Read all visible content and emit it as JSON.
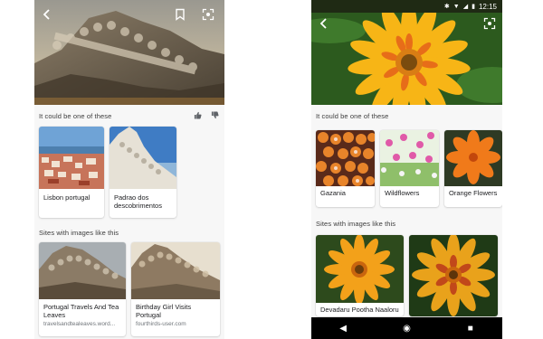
{
  "left_screen": {
    "related_heading": "It could be one of these",
    "related": [
      {
        "label": "Lisbon portugal"
      },
      {
        "label": "Padrao dos descobrimentos"
      }
    ],
    "sites_heading": "Sites with images like this",
    "sites": [
      {
        "title": "Portugal Travels And Tea Leaves",
        "source": "travelsandtealeaves.word..."
      },
      {
        "title": "Birthday Girl Visits Portugal",
        "source": "fourthirds-user.com"
      }
    ]
  },
  "right_screen": {
    "status_time": "12:15",
    "related_heading": "It could be one of these",
    "related": [
      {
        "label": "Gazania"
      },
      {
        "label": "Wildflowers"
      },
      {
        "label": "Orange Flowers"
      }
    ],
    "sites_heading": "Sites with images like this",
    "sites": [
      {
        "title": "Devadaru Pootha Naaloru"
      }
    ]
  },
  "icons": [
    "back-arrow-icon",
    "bookmark-icon",
    "lens-icon",
    "thumbs-up-icon",
    "thumbs-down-icon",
    "nav-back-icon",
    "nav-home-icon",
    "nav-recents-icon"
  ],
  "colors": {
    "section_bg": "#f7f7f7",
    "card_bg": "#ffffff",
    "gazania_orange": "#f59a12"
  }
}
